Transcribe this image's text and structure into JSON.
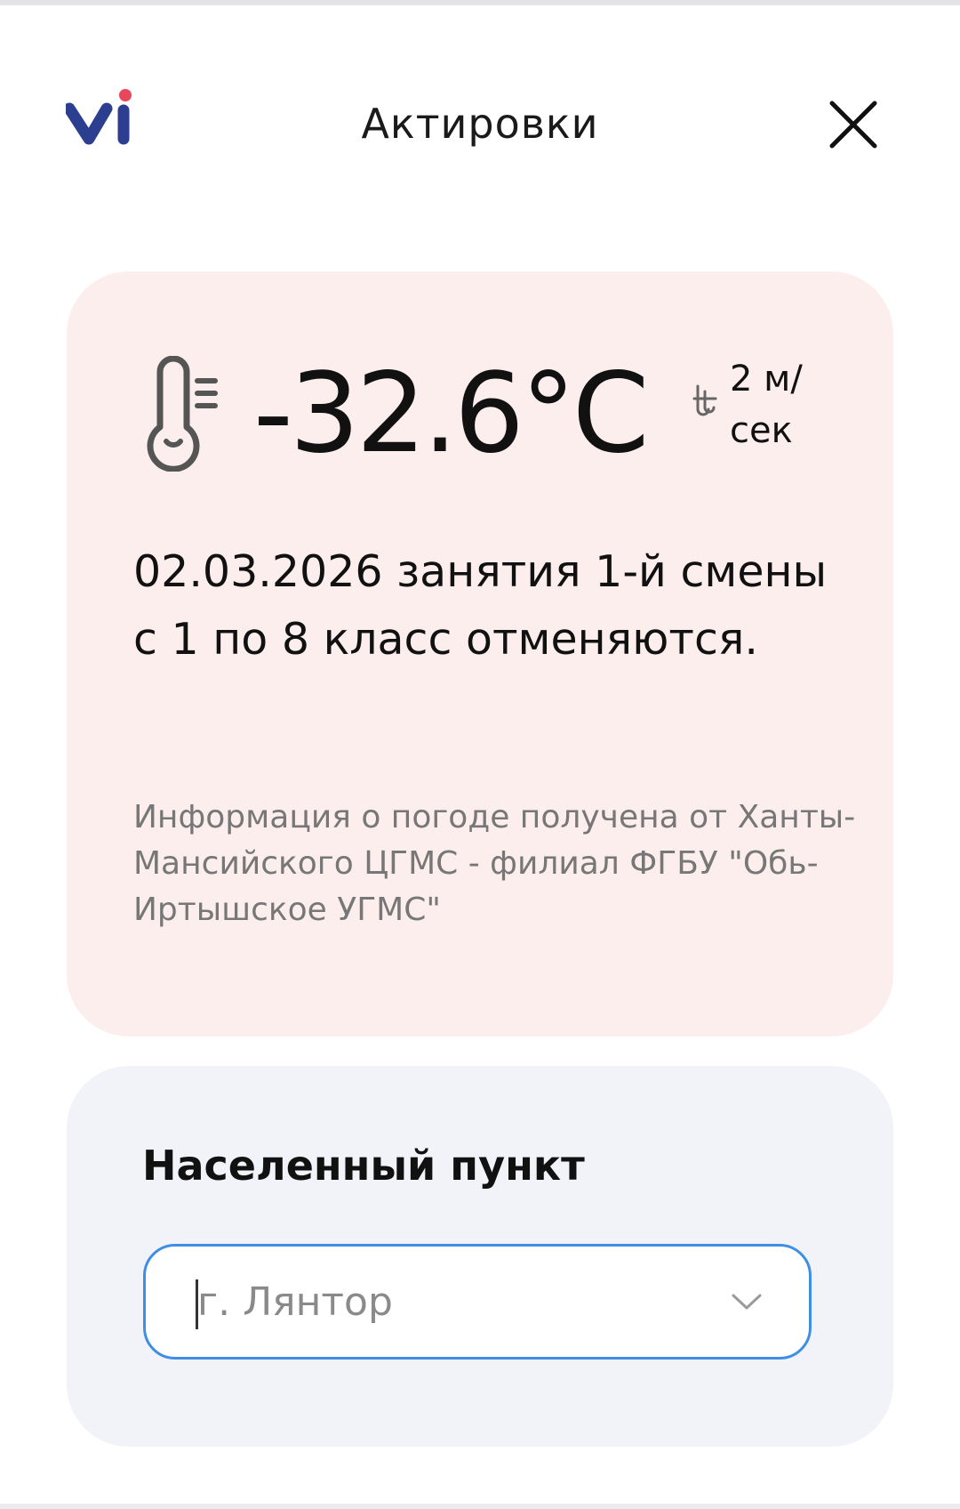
{
  "header": {
    "logo": {
      "text": "vi",
      "icon": "vi-logo",
      "dot_color": "#e8465a",
      "color": "#2c3e8f"
    },
    "title": "Актировки",
    "close_icon": "close-icon"
  },
  "weather": {
    "temperature": "-32.6°C",
    "thermometer_icon": "thermometer-icon",
    "wind_icon": "wind-icon",
    "wind": "2 м/сек",
    "message": "02.03.2026 занятия 1-й смены с 1 по 8 класс отменяются.",
    "source": "Информация о погоде получена от Ханты-Мансийского ЦГМС - филиал ФГБУ \"Обь-Иртышское УГМС\"",
    "card_color": "#fdeeee"
  },
  "location": {
    "label": "Населенный пункт",
    "selected_value": "г. Лянтор",
    "chevron_icon": "chevron-down-icon",
    "card_color": "#f1f3f9",
    "accent_color": "#3f8ee6"
  }
}
